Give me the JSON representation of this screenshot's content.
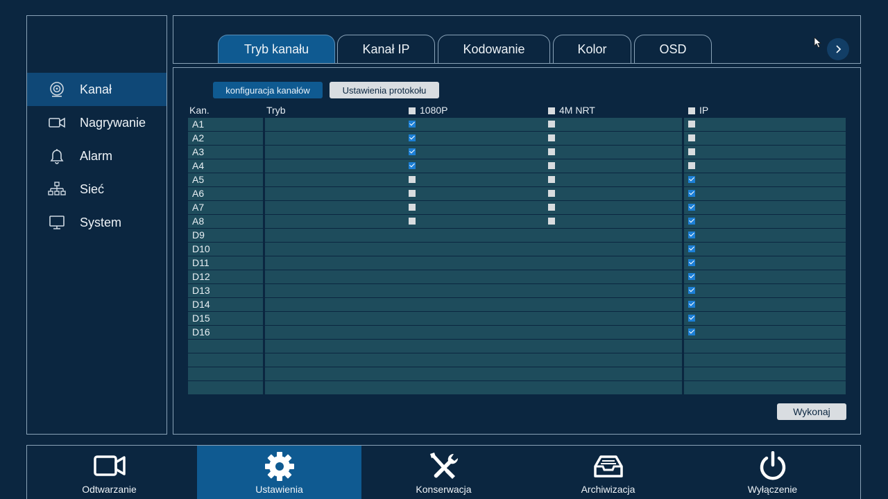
{
  "sidebar": {
    "items": [
      {
        "label": "Kanał",
        "icon": "camera-icon",
        "active": true
      },
      {
        "label": "Nagrywanie",
        "icon": "video-camera-icon",
        "active": false
      },
      {
        "label": "Alarm",
        "icon": "bell-icon",
        "active": false
      },
      {
        "label": "Sieć",
        "icon": "network-icon",
        "active": false
      },
      {
        "label": "System",
        "icon": "monitor-icon",
        "active": false
      }
    ]
  },
  "tabs": [
    {
      "label": "Tryb kanału",
      "active": true
    },
    {
      "label": "Kanał IP",
      "active": false
    },
    {
      "label": "Kodowanie",
      "active": false
    },
    {
      "label": "Kolor",
      "active": false
    },
    {
      "label": "OSD",
      "active": false
    }
  ],
  "subtabs": {
    "config_label": "konfiguracja kanałów",
    "protocol_label": "Ustawienia protokołu"
  },
  "table": {
    "headers": {
      "channel": "Kan.",
      "mode": "Tryb",
      "col1": "1080P",
      "col2": "4M NRT",
      "col3": "IP"
    },
    "rows": [
      {
        "name": "A1",
        "c1": true,
        "c2": false,
        "c3": false
      },
      {
        "name": "A2",
        "c1": true,
        "c2": false,
        "c3": false
      },
      {
        "name": "A3",
        "c1": true,
        "c2": false,
        "c3": false
      },
      {
        "name": "A4",
        "c1": true,
        "c2": false,
        "c3": false
      },
      {
        "name": "A5",
        "c1": false,
        "c2": false,
        "c3": true
      },
      {
        "name": "A6",
        "c1": false,
        "c2": false,
        "c3": true
      },
      {
        "name": "A7",
        "c1": false,
        "c2": false,
        "c3": true
      },
      {
        "name": "A8",
        "c1": false,
        "c2": false,
        "c3": true
      },
      {
        "name": "D9",
        "c1": null,
        "c2": null,
        "c3": true
      },
      {
        "name": "D10",
        "c1": null,
        "c2": null,
        "c3": true
      },
      {
        "name": "D11",
        "c1": null,
        "c2": null,
        "c3": true
      },
      {
        "name": "D12",
        "c1": null,
        "c2": null,
        "c3": true
      },
      {
        "name": "D13",
        "c1": null,
        "c2": null,
        "c3": true
      },
      {
        "name": "D14",
        "c1": null,
        "c2": null,
        "c3": true
      },
      {
        "name": "D15",
        "c1": null,
        "c2": null,
        "c3": true
      },
      {
        "name": "D16",
        "c1": null,
        "c2": null,
        "c3": true
      }
    ],
    "empty_rows": 4
  },
  "execute_label": "Wykonaj",
  "bottom_nav": [
    {
      "label": "Odtwarzanie",
      "icon": "playback-camera-icon",
      "active": false
    },
    {
      "label": "Ustawienia",
      "icon": "gear-icon",
      "active": true
    },
    {
      "label": "Konserwacja",
      "icon": "tools-icon",
      "active": false
    },
    {
      "label": "Archiwizacja",
      "icon": "archive-tray-icon",
      "active": false
    },
    {
      "label": "Wyłączenie",
      "icon": "power-icon",
      "active": false
    }
  ],
  "colors": {
    "accent": "#0f5a91",
    "background": "#0b2640",
    "row": "#1e4c5c",
    "checked": "#1c7fd6"
  }
}
